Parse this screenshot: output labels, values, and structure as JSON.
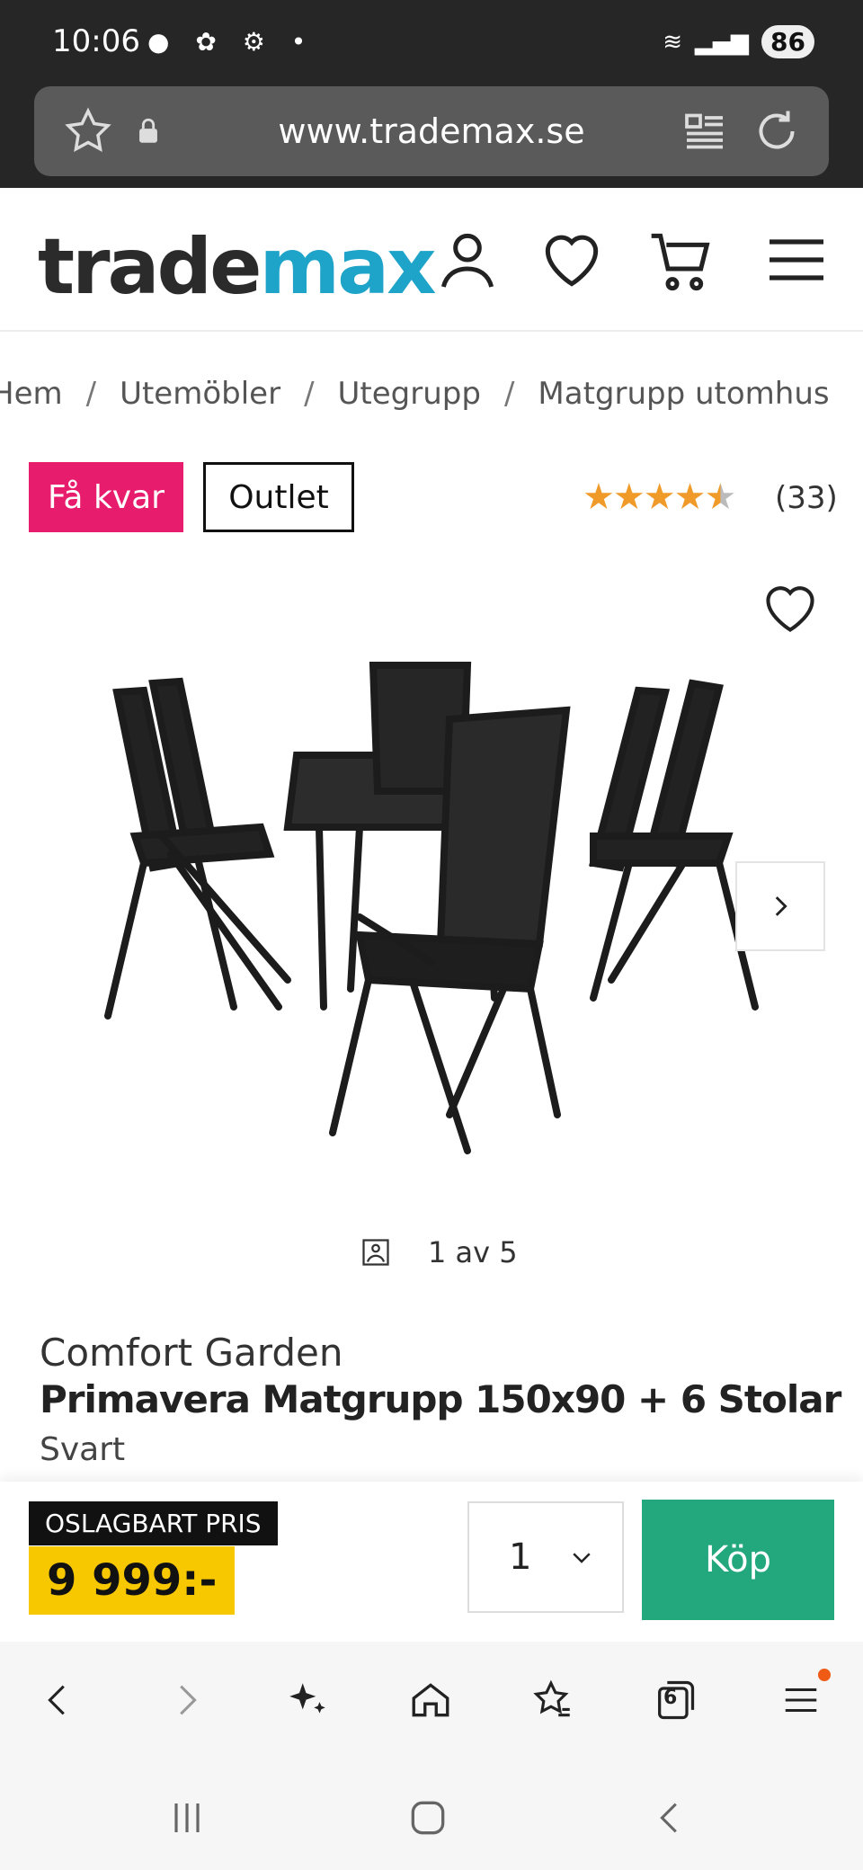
{
  "status_bar": {
    "time": "10:06",
    "battery": "86"
  },
  "browser": {
    "url": "www.trademax.se"
  },
  "site": {
    "logo_part1": "trade",
    "logo_part2": "max"
  },
  "breadcrumb": [
    "Hem",
    "Utemöbler",
    "Utegrupp",
    "Matgrupp utomhus"
  ],
  "badges": {
    "few_left": "Få kvar",
    "outlet": "Outlet"
  },
  "rating": {
    "stars": 4.5,
    "count": "(33)"
  },
  "gallery": {
    "counter": "1 av 5"
  },
  "product": {
    "brand": "Comfort Garden",
    "name": "Primavera Matgrupp 150x90 + 6 Stolar",
    "color": "Svart"
  },
  "buy_bar": {
    "price_label": "OSLAGBART PRIS",
    "price": "9 999:-",
    "quantity": "1",
    "buy_label": "Köp"
  },
  "browser_nav": {
    "tab_count": "6"
  },
  "colors": {
    "accent_blue": "#1ea3c9",
    "badge_pink": "#e81c6c",
    "buy_green": "#22a87c",
    "price_yellow": "#f7c800",
    "star_orange": "#f09a2a"
  }
}
